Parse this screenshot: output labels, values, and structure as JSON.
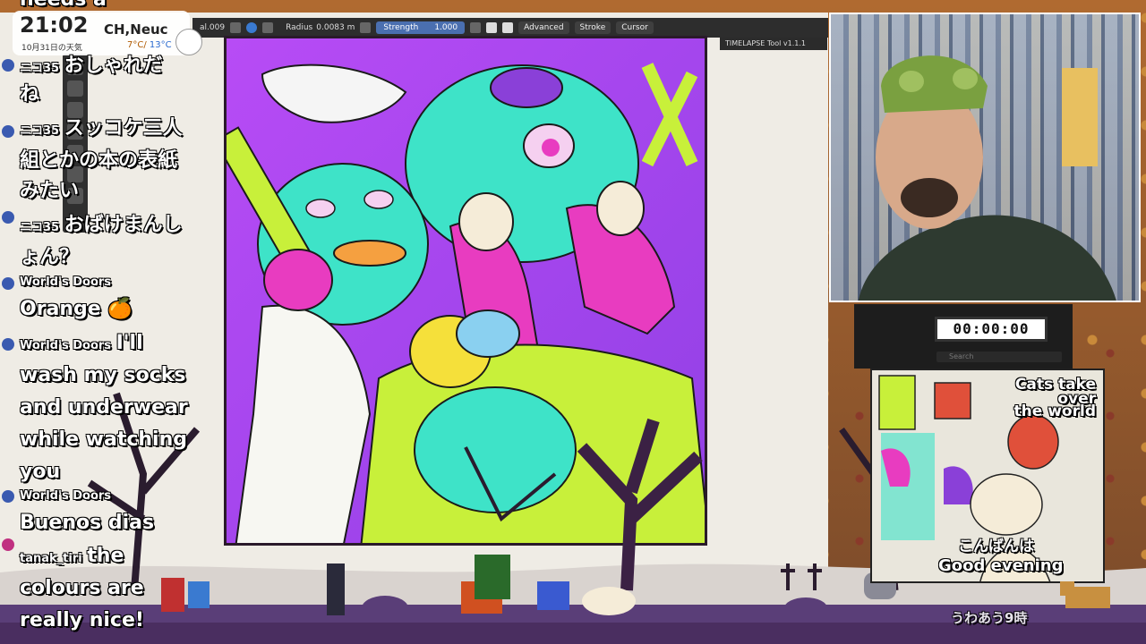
{
  "clock": {
    "time": "21:02",
    "location": "CH,Neuc",
    "date": "10月31日の天気",
    "temp_high": "7°C",
    "temp_low": "13°C"
  },
  "toolbar": {
    "brush_name": "al.009",
    "radius_label": "Radius",
    "radius_value": "0.0083 m",
    "strength_label": "Strength",
    "strength_value": "1.000",
    "advanced": "Advanced",
    "stroke": "Stroke",
    "cursor": "Cursor",
    "timelapse": "TIMELAPSE Tool v1.1.1"
  },
  "chat": {
    "messages": [
      {
        "author": "",
        "text": "needs a"
      },
      {
        "author": "ニコ35",
        "text": "おしゃれだ"
      },
      {
        "author": "",
        "text": "ね"
      },
      {
        "author": "ニコ35",
        "text": "スッコケ三人"
      },
      {
        "author": "",
        "text": "組とかの本の表紙"
      },
      {
        "author": "",
        "text": "みたい"
      },
      {
        "author": "ニコ35",
        "text": "おばけまんし"
      },
      {
        "author": "",
        "text": "ょん？"
      },
      {
        "author": "World's Doors",
        "text": "Orange 🍊"
      },
      {
        "author": "World's Doors",
        "text": "I'll"
      },
      {
        "author": "",
        "text": "wash my socks"
      },
      {
        "author": "",
        "text": "and underwear"
      },
      {
        "author": "",
        "text": "while watching"
      },
      {
        "author": "",
        "text": "you"
      },
      {
        "author": "World's Doors",
        "text": ""
      },
      {
        "author": "",
        "text": "Buenos dias"
      },
      {
        "author": "tanak_tiri",
        "text": "the"
      },
      {
        "author": "",
        "text": "colours are"
      },
      {
        "author": "",
        "text": "really nice!"
      }
    ]
  },
  "timer": {
    "value": "00:00:00",
    "search_placeholder": "Search"
  },
  "thumbnail": {
    "title_1": "Cats take",
    "title_2": "over",
    "title_3": "the world",
    "greet_jp": "こんばんは",
    "greet_en": "Good evening",
    "bottom_jp": "うわあう9時"
  },
  "colors": {
    "artwork_bg": "#a64cf0",
    "pumpkin_cyan": "#3ee3c8",
    "lime": "#c8f03a",
    "magenta": "#e83cc0",
    "ground": "#3a2a3e"
  }
}
